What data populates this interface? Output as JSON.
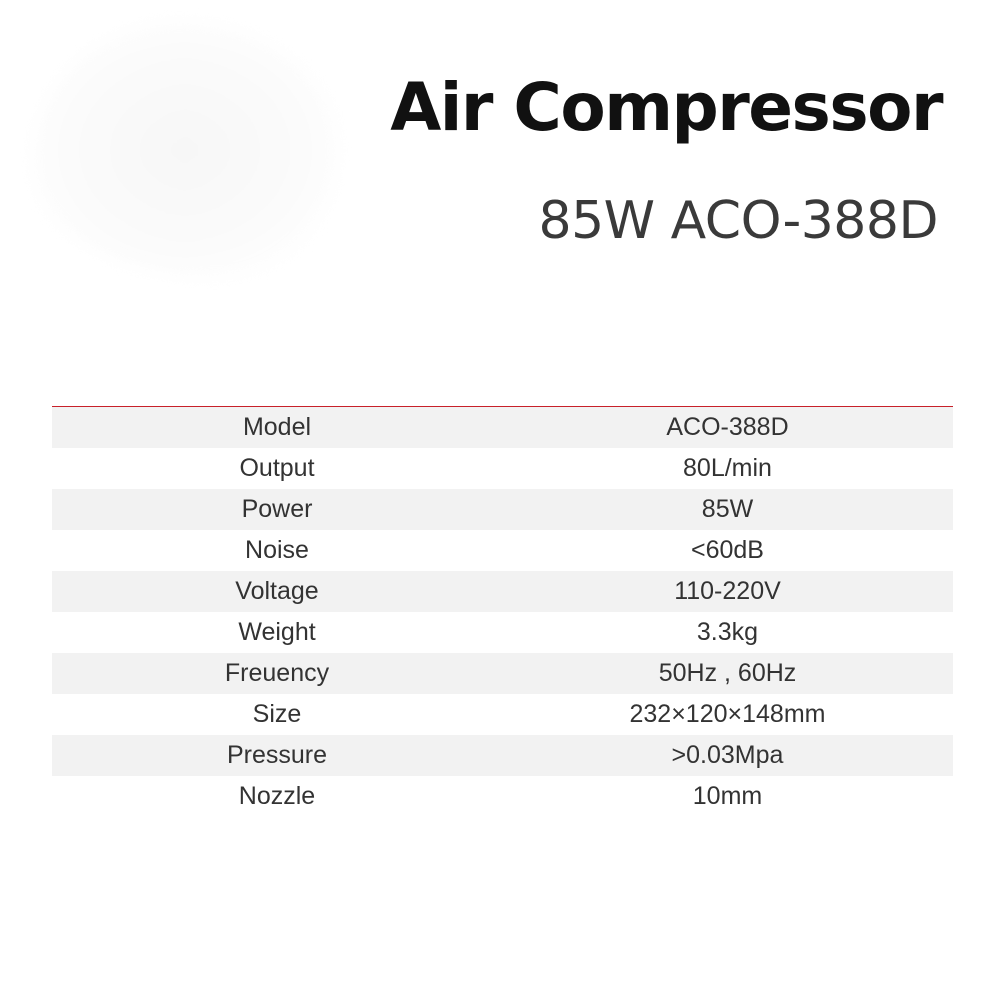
{
  "header": {
    "title": "Air Compressor",
    "subtitle": "85W ACO-388D"
  },
  "specs": [
    {
      "label": "Model",
      "value": "ACO-388D"
    },
    {
      "label": "Output",
      "value": "80L/min"
    },
    {
      "label": "Power",
      "value": "85W"
    },
    {
      "label": "Noise",
      "value": "<60dB"
    },
    {
      "label": "Voltage",
      "value": "110-220V"
    },
    {
      "label": "Weight",
      "value": "3.3kg"
    },
    {
      "label": "Freuency",
      "value": "50Hz , 60Hz"
    },
    {
      "label": "Size",
      "value": "232×120×148mm"
    },
    {
      "label": "Pressure",
      "value": ">0.03Mpa"
    },
    {
      "label": "Nozzle",
      "value": "10mm"
    }
  ],
  "colors": {
    "accent_line": "#c8202a",
    "row_shade": "#f2f2f2",
    "title_text": "#111111",
    "body_text": "#333333"
  }
}
